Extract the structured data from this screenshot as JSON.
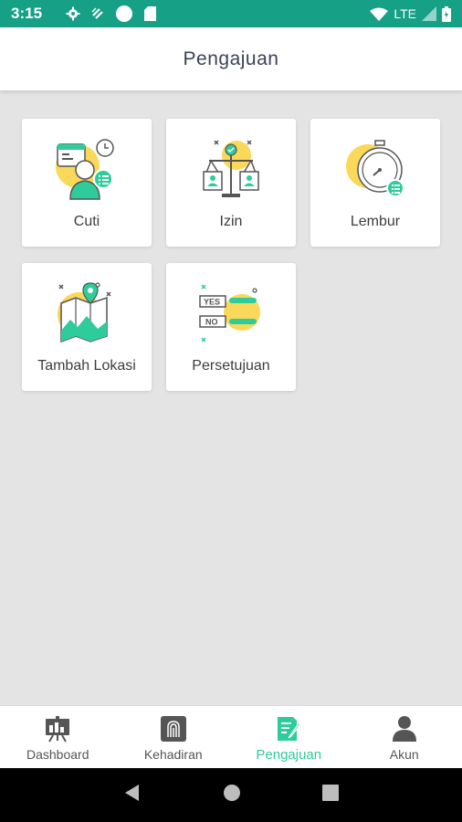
{
  "status_bar": {
    "time": "3:15",
    "network": "LTE",
    "icons": [
      "settings-icon",
      "sync-icon",
      "circle-icon",
      "sd-card-icon",
      "wifi-icon",
      "signal-icon",
      "battery-icon"
    ]
  },
  "header": {
    "title": "Pengajuan"
  },
  "menu": {
    "items": [
      {
        "label": "Cuti",
        "icon": "calendar-person-icon"
      },
      {
        "label": "Izin",
        "icon": "permission-scale-icon"
      },
      {
        "label": "Lembur",
        "icon": "stopwatch-icon"
      },
      {
        "label": "Tambah Lokasi",
        "icon": "map-pin-icon"
      },
      {
        "label": "Persetujuan",
        "icon": "yes-no-approval-icon"
      }
    ]
  },
  "bottom_nav": {
    "items": [
      {
        "label": "Dashboard",
        "icon": "dashboard-board-icon"
      },
      {
        "label": "Kehadiran",
        "icon": "fingerprint-icon"
      },
      {
        "label": "Pengajuan",
        "icon": "document-edit-icon",
        "active": true
      },
      {
        "label": "Akun",
        "icon": "person-icon"
      }
    ]
  },
  "colors": {
    "status_bar": "#16a085",
    "accent": "#2ecc9a",
    "yellow": "#f9d85a",
    "background": "#e4e4e4"
  }
}
